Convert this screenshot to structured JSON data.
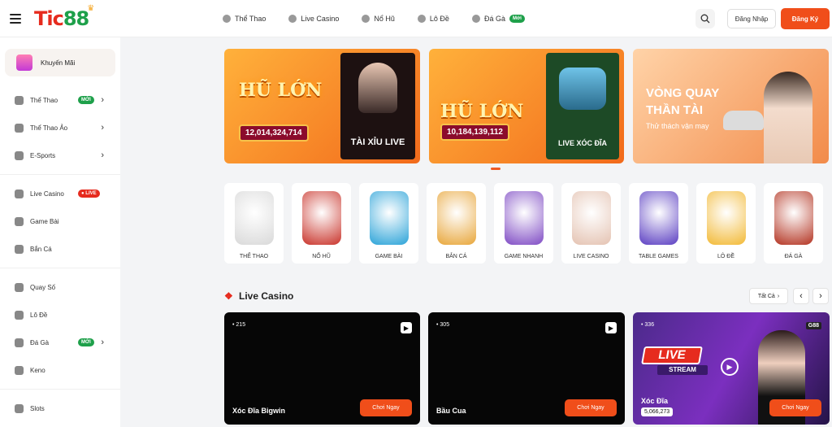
{
  "header": {
    "logo_text_1": "Tic",
    "logo_text_2": "88",
    "nav": [
      {
        "label": "Thể Thao",
        "icon": "soccer-icon"
      },
      {
        "label": "Live Casino",
        "icon": "cards-icon"
      },
      {
        "label": "Nổ Hũ",
        "icon": "slot-icon"
      },
      {
        "label": "Lô Đề",
        "icon": "lottery-icon"
      },
      {
        "label": "Đá Gà",
        "icon": "rooster-icon",
        "badge": "Mới"
      }
    ],
    "login_label": "Đăng Nhập",
    "register_label": "Đăng Ký"
  },
  "sidebar": {
    "promo_label": "Khuyến Mãi",
    "groups": [
      [
        {
          "label": "Thể Thao",
          "icon": "soccer-icon",
          "badge": "MỚI",
          "badge_color": "green",
          "chevron": true
        },
        {
          "label": "Thể Thao Ảo",
          "icon": "virtual-sport-icon",
          "chevron": true
        },
        {
          "label": "E-Sports",
          "icon": "gamepad-icon",
          "chevron": true
        }
      ],
      [
        {
          "label": "Live Casino",
          "icon": "cards-icon",
          "badge": "● LIVE",
          "badge_color": "red"
        },
        {
          "label": "Game Bài",
          "icon": "card-game-icon"
        },
        {
          "label": "Bắn Cá",
          "icon": "fish-icon"
        }
      ],
      [
        {
          "label": "Quay Số",
          "icon": "lottery-ball-icon"
        },
        {
          "label": "Lô Đề",
          "icon": "lottery-icon"
        },
        {
          "label": "Đá Gà",
          "icon": "rooster-icon",
          "badge": "MỚI",
          "badge_color": "green",
          "chevron": true
        },
        {
          "label": "Keno",
          "icon": "keno-icon"
        }
      ],
      [
        {
          "label": "Slots",
          "icon": "slot-icon"
        }
      ]
    ]
  },
  "banners": [
    {
      "title": "HŨ LỚN",
      "amount": "12,014,324,714",
      "tile_label": "TÀI XỈU LIVE"
    },
    {
      "title": "HŨ LỚN",
      "amount": "10,184,139,112",
      "tile_label": "LIVE XÓC ĐĨA"
    },
    {
      "title_line1": "VÒNG QUAY",
      "title_line2": "THẦN TÀI",
      "subtitle": "Thử thách vận may"
    }
  ],
  "categories": [
    {
      "label": "THỂ THAO",
      "color": "#d9d9d9"
    },
    {
      "label": "NỔ HŨ",
      "color": "#c9342b"
    },
    {
      "label": "GAME BÀI",
      "color": "#2ba3d8"
    },
    {
      "label": "BẮN CÁ",
      "color": "#e8a63a"
    },
    {
      "label": "GAME NHANH",
      "color": "#7f4bc4"
    },
    {
      "label": "LIVE CASINO",
      "color": "#e4c2b1"
    },
    {
      "label": "TABLE GAMES",
      "color": "#5b3fc2"
    },
    {
      "label": "LÔ ĐỀ",
      "color": "#f2b935"
    },
    {
      "label": "ĐÁ GÀ",
      "color": "#b33321"
    }
  ],
  "live_section": {
    "title": "Live Casino",
    "see_all": "Tất Cả",
    "cards": [
      {
        "count": "215",
        "name": "Xóc Đĩa Bigwin",
        "button": "Chơi Ngay"
      },
      {
        "count": "305",
        "name": "Bầu Cua",
        "button": "Chơi Ngay"
      },
      {
        "count": "336",
        "name": "Xóc Đĩa",
        "amount": "5,066,273",
        "button": "Chơi Ngay",
        "live_text": "LIVE",
        "stream_text": "STREAM",
        "brand": "G88"
      }
    ]
  }
}
